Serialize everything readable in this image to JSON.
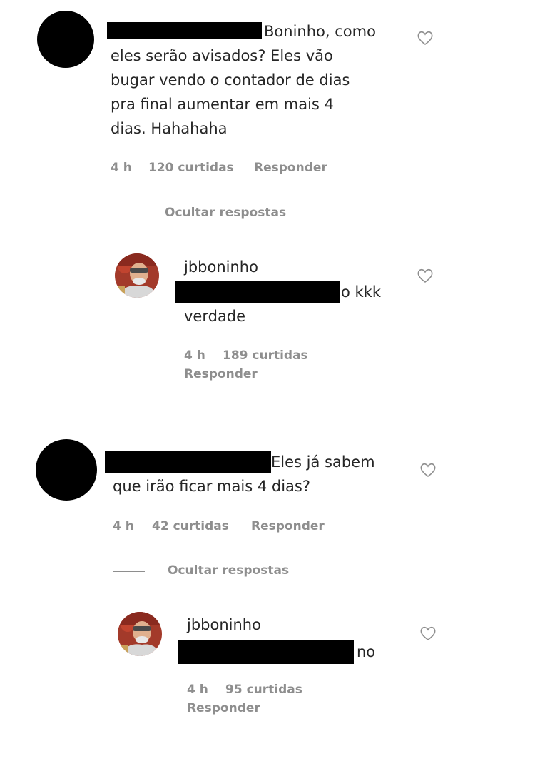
{
  "thread1": {
    "comment": {
      "text_first_line": "Boninho, como",
      "text_lines": [
        "eles serão avisados? Eles vão",
        "bugar vendo o contador de dias",
        "pra final aumentar em mais 4",
        "dias. Hahahaha"
      ],
      "time": "4 h",
      "likes": "120 curtidas",
      "reply": "Responder"
    },
    "hide_replies": "Ocultar respostas",
    "reply": {
      "username": "jbboninho",
      "text_tail": "o kkk",
      "text_line2": "verdade",
      "time": "4 h",
      "likes": "189 curtidas",
      "reply": "Responder"
    }
  },
  "thread2": {
    "comment": {
      "text_first_line": "Eles já sabem",
      "text_line2": "que irão ficar mais 4 dias?",
      "time": "4 h",
      "likes": "42 curtidas",
      "reply": "Responder"
    },
    "hide_replies": "Ocultar respostas",
    "reply": {
      "username": "jbboninho",
      "text_tail": "no",
      "time": "4 h",
      "likes": "95 curtidas",
      "reply": "Responder"
    }
  },
  "icons": {
    "like": "heart-outline-icon"
  }
}
